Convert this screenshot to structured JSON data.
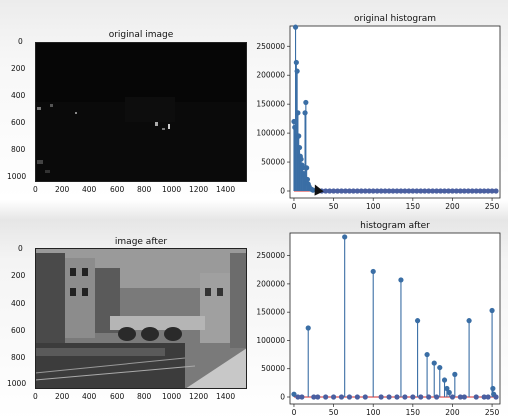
{
  "panels": {
    "original_image": {
      "title": "original image",
      "yticks": [
        "0",
        "200",
        "400",
        "600",
        "800",
        "1000"
      ],
      "xticks": [
        "0",
        "200",
        "400",
        "600",
        "800",
        "1000",
        "1200",
        "1400"
      ]
    },
    "image_after": {
      "title": "image after",
      "yticks": [
        "0",
        "200",
        "400",
        "600",
        "800",
        "1000"
      ],
      "xticks": [
        "0",
        "200",
        "400",
        "600",
        "800",
        "1000",
        "1200",
        "1400"
      ]
    }
  },
  "chart_data": [
    {
      "type": "scatter",
      "title": "original histogram",
      "marker": "stem",
      "color": "#3a6ea5",
      "xlim": [
        -5,
        260
      ],
      "ylim": [
        0,
        285000
      ],
      "xticks": [
        0,
        50,
        100,
        150,
        200,
        250
      ],
      "yticks": [
        0,
        50000,
        100000,
        150000,
        200000,
        250000
      ],
      "points": [
        [
          0,
          120000
        ],
        [
          1,
          110000
        ],
        [
          2,
          283000
        ],
        [
          3,
          222000
        ],
        [
          4,
          207000
        ],
        [
          5,
          135000
        ],
        [
          6,
          95000
        ],
        [
          7,
          75000
        ],
        [
          8,
          60000
        ],
        [
          9,
          55000
        ],
        [
          10,
          45000
        ],
        [
          11,
          40000
        ],
        [
          12,
          30000
        ],
        [
          13,
          25000
        ],
        [
          14,
          135000
        ],
        [
          15,
          153000
        ],
        [
          16,
          40000
        ],
        [
          17,
          20000
        ],
        [
          18,
          12000
        ],
        [
          19,
          8000
        ],
        [
          20,
          5000
        ],
        [
          22,
          3000
        ],
        [
          24,
          1500
        ],
        [
          30,
          0
        ],
        [
          35,
          0
        ],
        [
          40,
          0
        ],
        [
          45,
          0
        ],
        [
          50,
          0
        ],
        [
          55,
          0
        ],
        [
          60,
          0
        ],
        [
          65,
          0
        ],
        [
          70,
          0
        ],
        [
          75,
          0
        ],
        [
          80,
          0
        ],
        [
          85,
          0
        ],
        [
          90,
          0
        ],
        [
          95,
          0
        ],
        [
          100,
          0
        ],
        [
          105,
          0
        ],
        [
          110,
          0
        ],
        [
          115,
          0
        ],
        [
          120,
          0
        ],
        [
          125,
          0
        ],
        [
          130,
          0
        ],
        [
          135,
          0
        ],
        [
          140,
          0
        ],
        [
          145,
          0
        ],
        [
          150,
          0
        ],
        [
          155,
          0
        ],
        [
          160,
          0
        ],
        [
          165,
          0
        ],
        [
          170,
          0
        ],
        [
          175,
          0
        ],
        [
          180,
          0
        ],
        [
          185,
          0
        ],
        [
          190,
          0
        ],
        [
          195,
          0
        ],
        [
          200,
          0
        ],
        [
          205,
          0
        ],
        [
          210,
          0
        ],
        [
          215,
          0
        ],
        [
          220,
          0
        ],
        [
          225,
          0
        ],
        [
          230,
          0
        ],
        [
          235,
          0
        ],
        [
          240,
          0
        ],
        [
          245,
          0
        ],
        [
          250,
          0
        ],
        [
          255,
          0
        ]
      ]
    },
    {
      "type": "scatter",
      "title": "histogram after",
      "marker": "stem",
      "color": "#3a6ea5",
      "xlim": [
        -5,
        260
      ],
      "ylim": [
        0,
        290000
      ],
      "xticks": [
        0,
        50,
        100,
        150,
        200,
        250
      ],
      "yticks": [
        0,
        50000,
        100000,
        150000,
        200000,
        250000
      ],
      "points": [
        [
          0,
          5000
        ],
        [
          18,
          122000
        ],
        [
          64,
          283000
        ],
        [
          100,
          222000
        ],
        [
          135,
          207000
        ],
        [
          156,
          135000
        ],
        [
          168,
          75000
        ],
        [
          177,
          60000
        ],
        [
          184,
          52000
        ],
        [
          190,
          30000
        ],
        [
          193,
          15000
        ],
        [
          196,
          8000
        ],
        [
          203,
          40000
        ],
        [
          221,
          135000
        ],
        [
          250,
          153000
        ],
        [
          251,
          15000
        ],
        [
          252,
          5000
        ],
        [
          5,
          0
        ],
        [
          10,
          0
        ],
        [
          25,
          0
        ],
        [
          30,
          0
        ],
        [
          40,
          0
        ],
        [
          50,
          0
        ],
        [
          60,
          0
        ],
        [
          70,
          0
        ],
        [
          80,
          0
        ],
        [
          90,
          0
        ],
        [
          110,
          0
        ],
        [
          120,
          0
        ],
        [
          130,
          0
        ],
        [
          140,
          0
        ],
        [
          150,
          0
        ],
        [
          160,
          0
        ],
        [
          170,
          0
        ],
        [
          180,
          0
        ],
        [
          200,
          0
        ],
        [
          210,
          0
        ],
        [
          215,
          0
        ],
        [
          230,
          0
        ],
        [
          240,
          0
        ],
        [
          245,
          0
        ],
        [
          255,
          0
        ]
      ]
    }
  ]
}
